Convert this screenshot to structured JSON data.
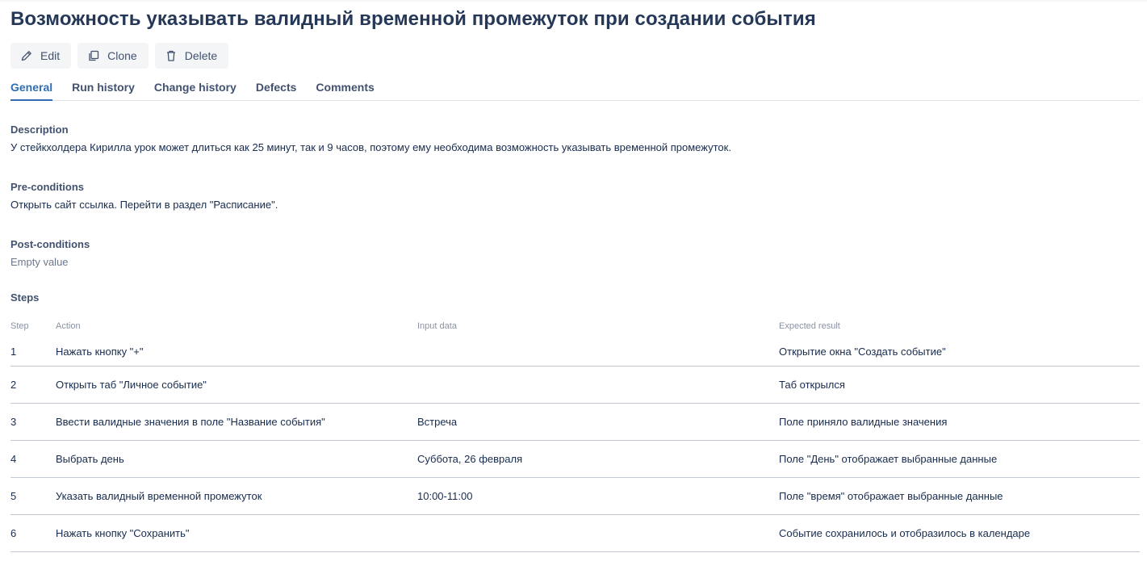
{
  "title": "Возможность указывать валидный временной промежуток при создании события",
  "toolbar": {
    "edit_label": "Edit",
    "clone_label": "Clone",
    "delete_label": "Delete",
    "edit_icon": "pencil-icon",
    "clone_icon": "copy-icon",
    "delete_icon": "trash-icon"
  },
  "tabs": [
    {
      "label": "General",
      "active": true
    },
    {
      "label": "Run history"
    },
    {
      "label": "Change history"
    },
    {
      "label": "Defects"
    },
    {
      "label": "Comments"
    }
  ],
  "description": {
    "title": "Description",
    "text": "У стейкхолдера Кирилла урок может длиться как 25 минут, так и 9 часов, поэтому ему необходима возможность указывать временной промежуток."
  },
  "preconditions": {
    "title": "Pre-conditions",
    "text": "Открыть сайт ссылка. Перейти в раздел \"Расписание\"."
  },
  "postconditions": {
    "title": "Post-conditions",
    "text": "Empty value"
  },
  "steps": {
    "title": "Steps",
    "headers": {
      "step": "Step",
      "action": "Action",
      "input": "Input data",
      "expected": "Expected result"
    },
    "rows": [
      {
        "step": "1",
        "action": "Нажать кнопку \"+\"",
        "input": "",
        "expected": "Открытие окна \"Создать событие\""
      },
      {
        "step": "2",
        "action": "Открыть таб \"Личное событие\"",
        "input": "",
        "expected": "Таб открылся"
      },
      {
        "step": "3",
        "action": "Ввести валидные значения в поле \"Название события\"",
        "input": "Встреча",
        "expected": "Поле приняло валидные значения"
      },
      {
        "step": "4",
        "action": "Выбрать день",
        "input": "Суббота, 26 февраля",
        "expected": "Поле \"День\" отображает выбранные данные"
      },
      {
        "step": "5",
        "action": "Указать валидный временной промежуток",
        "input": "10:00-11:00",
        "expected": "Поле \"время\" отображает выбранные данные"
      },
      {
        "step": "6",
        "action": "Нажать кнопку \"Сохранить\"",
        "input": "",
        "expected": "Событие сохранилось и отобразилось в календаре"
      }
    ]
  }
}
